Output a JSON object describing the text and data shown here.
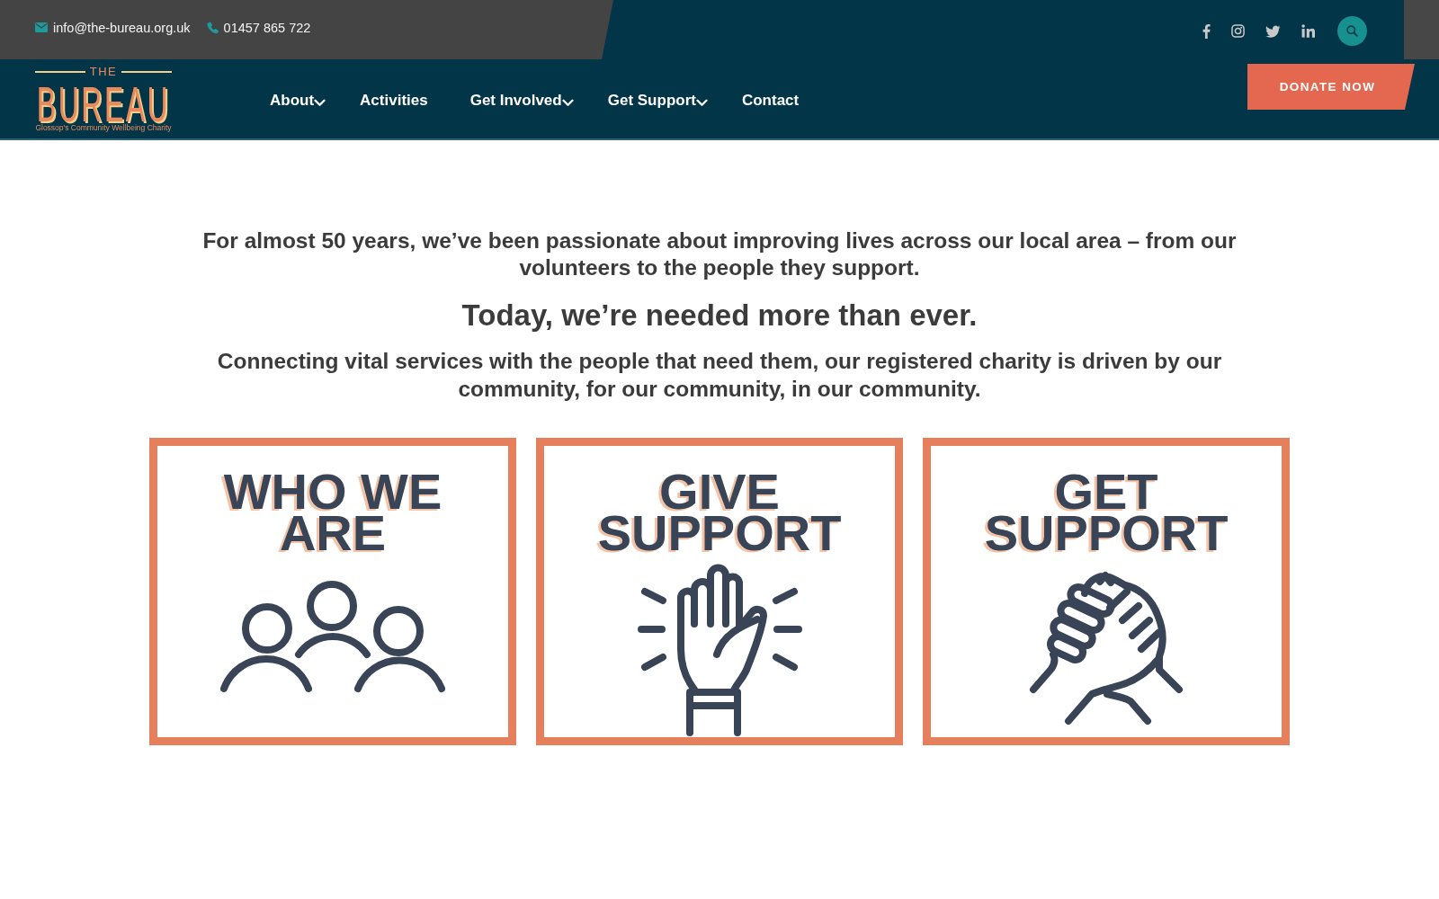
{
  "top_bar": {
    "email": "info@the-bureau.org.uk",
    "phone": "01457 865 722"
  },
  "logo": {
    "overline": "THE",
    "wordmark": "BUREAU",
    "tagline": "Glossop's Community Wellbeing Charity"
  },
  "nav": {
    "items": [
      {
        "label": "About",
        "dropdown": true
      },
      {
        "label": "Activities",
        "dropdown": false
      },
      {
        "label": "Get Involved",
        "dropdown": true
      },
      {
        "label": "Get Support",
        "dropdown": true
      },
      {
        "label": "Contact",
        "dropdown": false
      }
    ]
  },
  "donate_button": {
    "label": "DONATE NOW"
  },
  "intro": {
    "lead": "For almost 50 years, we’ve been passionate about improving lives across our local area – from our volunteers to the people they support.",
    "headline": "Today, we’re needed more than ever.",
    "mission": "Connecting vital services with the people that need them, our registered charity is driven by our community, for our community, in our community."
  },
  "cards": [
    {
      "title": "WHO WE ARE",
      "kind": "people"
    },
    {
      "title": "GIVE SUPPORT",
      "kind": "raised-hand"
    },
    {
      "title": "GET SUPPORT",
      "kind": "handshake"
    }
  ]
}
